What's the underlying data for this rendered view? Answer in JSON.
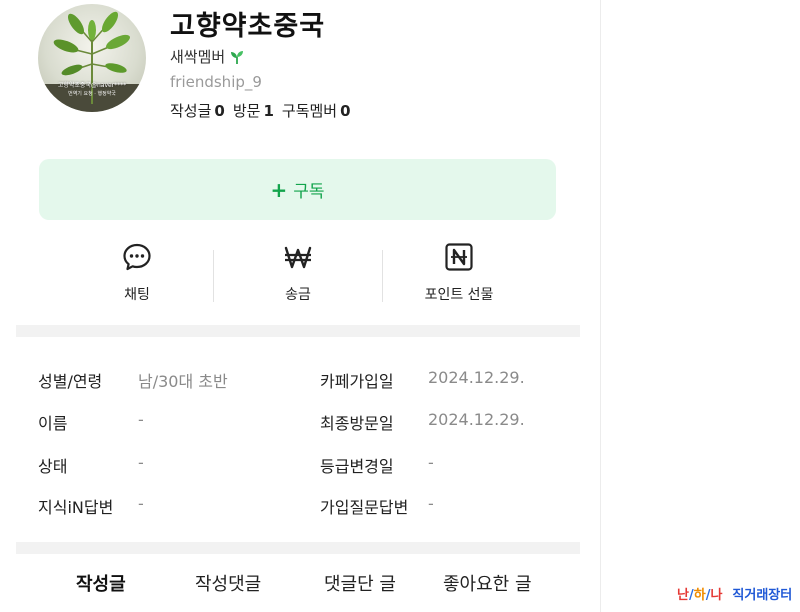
{
  "profile": {
    "cafe_name": "고향약초중국",
    "member_grade": "새싹멤버",
    "user_id": "friendship_9",
    "avatar_caption": "고향약초중국@naver****",
    "avatar_caption2": "번역기 요청 · 행정약국",
    "stats": {
      "posts_label": "작성글",
      "posts_value": "0",
      "visits_label": "방문",
      "visits_value": "1",
      "subscribers_label": "구독멤버",
      "subscribers_value": "0"
    }
  },
  "subscribe": {
    "label": "구독",
    "plus": "+"
  },
  "actions": [
    {
      "label": "채팅",
      "icon": "chat-icon"
    },
    {
      "label": "송금",
      "icon": "won-icon"
    },
    {
      "label": "포인트 선물",
      "icon": "naver-n-icon"
    }
  ],
  "info": {
    "gender_age": {
      "label": "성별/연령",
      "value": "남/30대 초반"
    },
    "cafe_join_date": {
      "label": "카페가입일",
      "value": "2024.12.29."
    },
    "name": {
      "label": "이름",
      "value": "-"
    },
    "last_visit": {
      "label": "최종방문일",
      "value": "2024.12.29."
    },
    "status": {
      "label": "상태",
      "value": "-"
    },
    "grade_change": {
      "label": "등급변경일",
      "value": "-"
    },
    "kin_answers": {
      "label": "지식iN답변",
      "value": "-"
    },
    "join_question": {
      "label": "가입질문답변",
      "value": "-"
    }
  },
  "tabs": [
    {
      "label": "작성글",
      "active": true
    },
    {
      "label": "작성댓글",
      "active": false
    },
    {
      "label": "댓글단 글",
      "active": false
    },
    {
      "label": "좋아요한 글",
      "active": false
    }
  ],
  "watermark": {
    "part1": "난",
    "sep1": "/",
    "part2": "하",
    "sep2": "/",
    "part3": "나",
    "suffix": "직거래장터"
  },
  "colors": {
    "accent_green": "#12a44c",
    "subscribe_bg": "#e4f8ec",
    "band_gray": "#f2f2f2"
  }
}
